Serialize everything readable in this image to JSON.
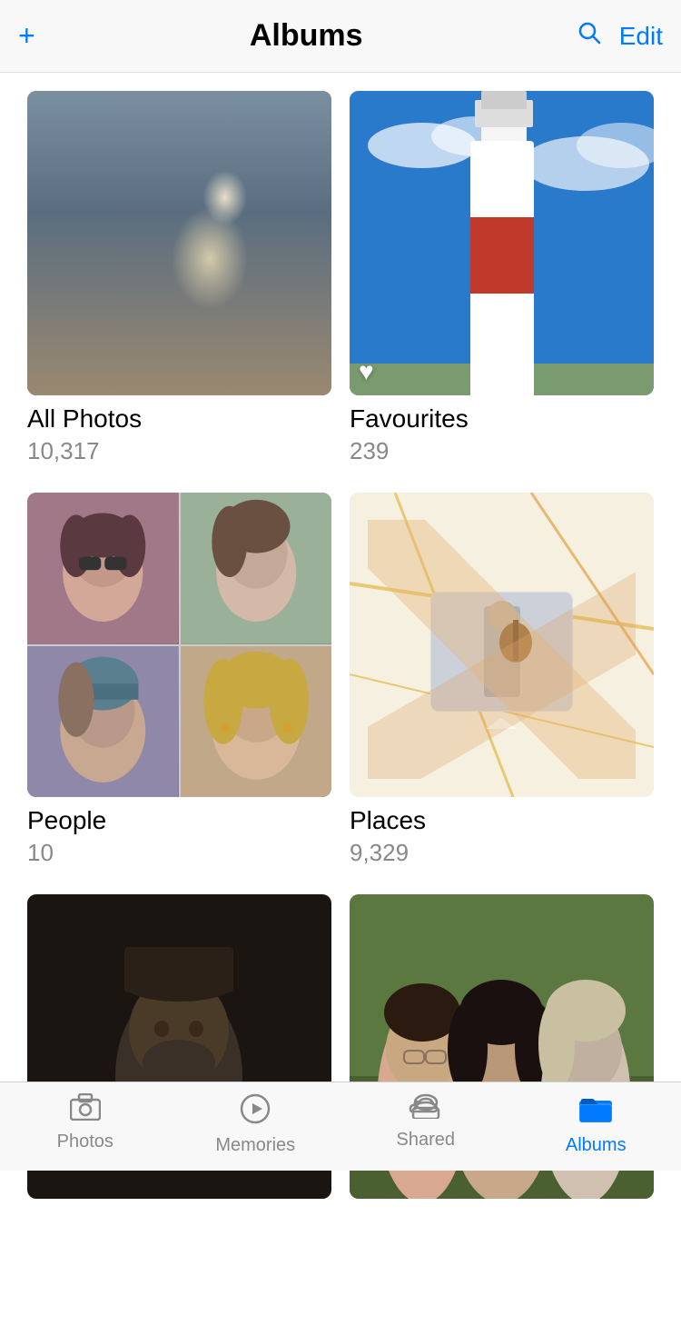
{
  "header": {
    "add_label": "+",
    "title": "Albums",
    "edit_label": "Edit"
  },
  "albums": [
    {
      "id": "all-photos",
      "name": "All Photos",
      "count": "10,317",
      "has_heart": false
    },
    {
      "id": "favourites",
      "name": "Favourites",
      "count": "239",
      "has_heart": true
    },
    {
      "id": "people",
      "name": "People",
      "count": "10",
      "has_heart": false
    },
    {
      "id": "places",
      "name": "Places",
      "count": "9,329",
      "has_heart": false
    },
    {
      "id": "album-5",
      "name": "",
      "count": "",
      "has_heart": false
    },
    {
      "id": "album-6",
      "name": "",
      "count": "",
      "has_heart": false
    }
  ],
  "tab_bar": {
    "tabs": [
      {
        "id": "photos",
        "label": "Photos",
        "active": false
      },
      {
        "id": "memories",
        "label": "Memories",
        "active": false
      },
      {
        "id": "shared",
        "label": "Shared",
        "active": false
      },
      {
        "id": "albums",
        "label": "Albums",
        "active": true
      }
    ]
  }
}
